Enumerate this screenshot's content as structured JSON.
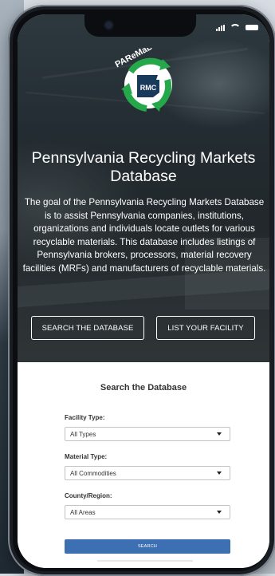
{
  "app": {
    "logo_text": "PAReMaDe",
    "logo_badge": "RMC"
  },
  "hero": {
    "title": "Pennsylvania Recycling Markets Database",
    "description": "The goal of the Pennsylvania Recycling Markets Database is to assist Pennsylvania companies, institutions, organizations and individuals locate outlets for various recyclable materials. This database includes listings of Pennsylvania brokers, processors, material recovery facilities (MRFs) and manufacturers of recyclable materials.",
    "buttons": {
      "search": "SEARCH THE DATABASE",
      "list": "LIST YOUR FACILITY"
    }
  },
  "search": {
    "title": "Search the Database",
    "facility": {
      "label": "Facility Type:",
      "value": "All Types"
    },
    "material": {
      "label": "Material Type:",
      "value": "All Commodities"
    },
    "county": {
      "label": "County/Region:",
      "value": "All Areas"
    },
    "submit": "SEARCH"
  },
  "colors": {
    "accent": "#3d70b2",
    "logo_green": "#25a84a",
    "phone_frame": "#1a1d22"
  }
}
